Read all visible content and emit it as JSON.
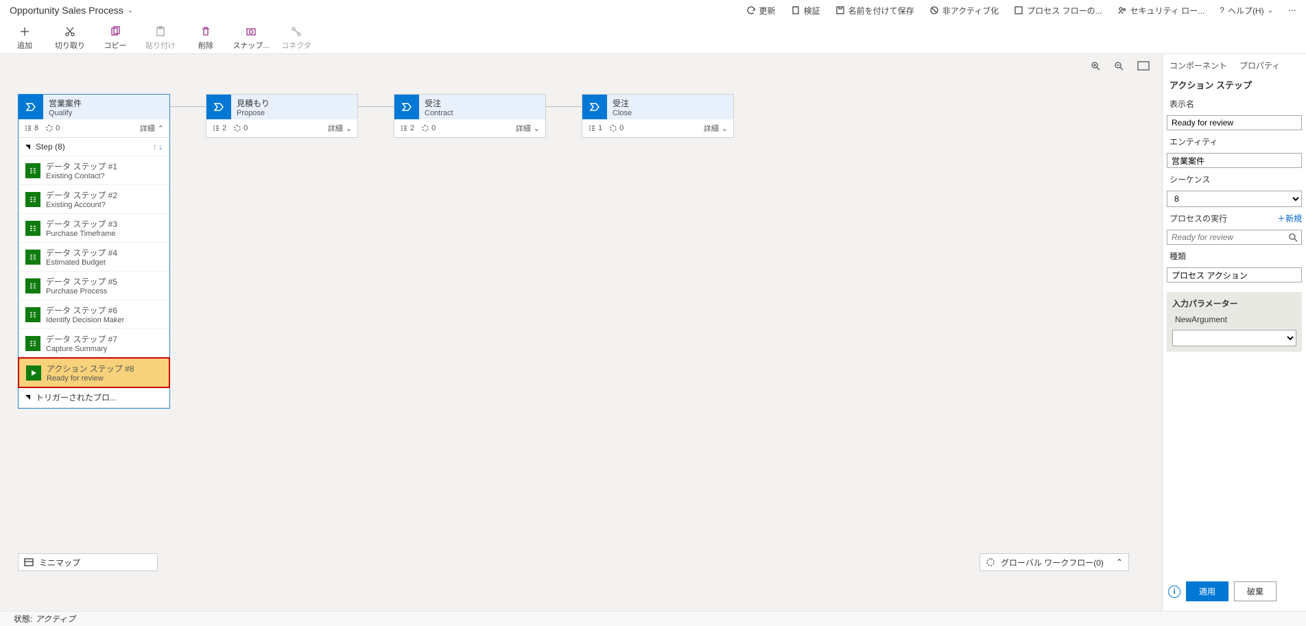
{
  "title": "Opportunity Sales Process",
  "topActions": {
    "refresh": "更新",
    "validate": "検証",
    "saveAs": "名前を付けて保存",
    "deactivate": "非アクティブ化",
    "processFlow": "プロセス フローの...",
    "security": "セキュリティ ロー...",
    "help": "ヘルプ(H)"
  },
  "commands": {
    "add": "追加",
    "cut": "切り取り",
    "copy": "コピー",
    "paste": "貼り付け",
    "delete": "削除",
    "snapshot": "スナップ...",
    "connector": "コネクタ"
  },
  "stages": [
    {
      "jp": "営業案件",
      "en": "Qualify",
      "steps": 8,
      "wf": 0,
      "detail": "詳細",
      "selected": true
    },
    {
      "jp": "見積もり",
      "en": "Propose",
      "steps": 2,
      "wf": 0,
      "detail": "詳細",
      "selected": false
    },
    {
      "jp": "受注",
      "en": "Contract",
      "steps": 2,
      "wf": 0,
      "detail": "詳細",
      "selected": false
    },
    {
      "jp": "受注",
      "en": "Close",
      "steps": 1,
      "wf": 0,
      "detail": "詳細",
      "selected": false
    }
  ],
  "stepSectionTitle": "Step (8)",
  "steps": [
    {
      "title": "データ ステップ #1",
      "sub": "Existing Contact?"
    },
    {
      "title": "データ ステップ #2",
      "sub": "Existing Account?"
    },
    {
      "title": "データ ステップ #3",
      "sub": "Purchase Timeframe"
    },
    {
      "title": "データ ステップ #4",
      "sub": "Estimated Budget"
    },
    {
      "title": "データ ステップ #5",
      "sub": "Purchase Process"
    },
    {
      "title": "データ ステップ #6",
      "sub": "Identify Decision Maker"
    },
    {
      "title": "データ ステップ #7",
      "sub": "Capture Summary"
    },
    {
      "title": "アクション ステップ #8",
      "sub": "Ready for review",
      "action": true,
      "selected": true
    }
  ],
  "triggeredSection": "トリガーされたプロ...",
  "minimap": "ミニマップ",
  "globalWorkflow": "グローバル ワークフロー(0)",
  "status": {
    "label": "状態:",
    "value": "アクティブ"
  },
  "panel": {
    "tabs": {
      "components": "コンポーネント",
      "properties": "プロパティ"
    },
    "title": "アクション ステップ",
    "displayName": {
      "label": "表示名",
      "value": "Ready for review"
    },
    "entity": {
      "label": "エンティティ",
      "value": "営業案件"
    },
    "sequence": {
      "label": "シーケンス",
      "value": "8"
    },
    "runProcess": {
      "label": "プロセスの実行",
      "placeholder": "Ready for review",
      "new": "＋新規"
    },
    "type": {
      "label": "種類",
      "value": "プロセス アクション"
    },
    "params": {
      "title": "入力パラメーター",
      "name": "NewArgument"
    },
    "apply": "適用",
    "discard": "破棄"
  }
}
